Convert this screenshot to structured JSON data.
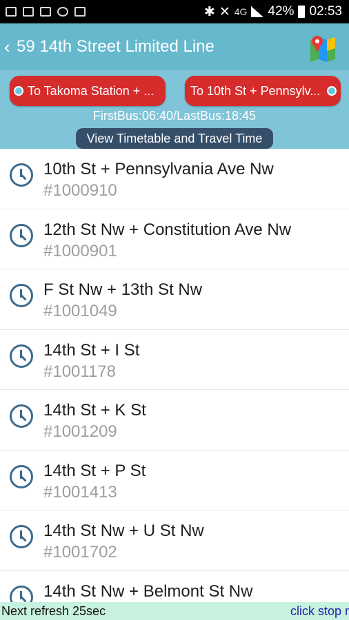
{
  "status_bar": {
    "battery": "42%",
    "time": "02:53",
    "network": "4G"
  },
  "app_bar": {
    "back_glyph": "‹",
    "title": "59 14th Street Limited Line"
  },
  "route": {
    "direction_left": "To Takoma Station + ...",
    "direction_right": "To 10th St + Pennsylv...",
    "first_last": "FirstBus:06:40/LastBus:18:45",
    "timetable_button": "View Timetable and Travel Time"
  },
  "stops": [
    {
      "name": "10th St + Pennsylvania Ave Nw",
      "id": "#1000910"
    },
    {
      "name": "12th St Nw + Constitution Ave Nw",
      "id": "#1000901"
    },
    {
      "name": "F St Nw + 13th St Nw",
      "id": "#1001049"
    },
    {
      "name": "14th St + I St",
      "id": "#1001178"
    },
    {
      "name": "14th St + K St",
      "id": "#1001209"
    },
    {
      "name": "14th St + P St",
      "id": "#1001413"
    },
    {
      "name": "14th St Nw + U St Nw",
      "id": "#1001702"
    },
    {
      "name": "14th St Nw + Belmont St Nw",
      "id": ""
    }
  ],
  "bottom_bar": {
    "refresh": "Next refresh 25sec",
    "hint": "click stop na"
  },
  "colors": {
    "app_bar": "#66b8cc",
    "route_header": "#7fc4d8",
    "direction_button": "#d62c2c",
    "timetable_button": "#354e6a",
    "clock_icon": "#3d6a8c",
    "bottom_bar": "#c8f2e0"
  }
}
